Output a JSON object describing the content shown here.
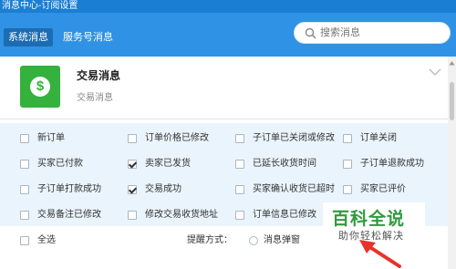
{
  "window": {
    "title": "消息中心-订阅设置"
  },
  "tabs": [
    {
      "label": "系统消息",
      "active": true
    },
    {
      "label": "服务号消息",
      "active": false
    }
  ],
  "search": {
    "placeholder": "搜索消息"
  },
  "card": {
    "title": "交易消息",
    "subtitle": "交易消息",
    "icon": "dollar-coin-icon"
  },
  "options": [
    {
      "label": "新订单",
      "checked": false
    },
    {
      "label": "订单价格已修改",
      "checked": false
    },
    {
      "label": "子订单已关闭或修改",
      "checked": false
    },
    {
      "label": "订单关闭",
      "checked": false
    },
    {
      "label": "买家已付款",
      "checked": false
    },
    {
      "label": "卖家已发货",
      "checked": true
    },
    {
      "label": "已延长收货时间",
      "checked": false
    },
    {
      "label": "子订单退款成功",
      "checked": false
    },
    {
      "label": "子订单打款成功",
      "checked": false
    },
    {
      "label": "交易成功",
      "checked": true
    },
    {
      "label": "买家确认收货已超时",
      "checked": false
    },
    {
      "label": "买家已评价",
      "checked": false
    },
    {
      "label": "交易备注已修改",
      "checked": false
    },
    {
      "label": "修改交易收货地址",
      "checked": false
    },
    {
      "label": "订单信息已修改",
      "checked": false
    }
  ],
  "footer": {
    "select_all": "全选",
    "reminder_label": "提醒方式：",
    "reminder_option": "消息弹窗"
  },
  "watermark": {
    "main": "百科全说",
    "sub": "助你轻松解决"
  },
  "colors": {
    "header": "#2f92e4",
    "active_tab": "#1c6cb4",
    "grid_bg": "#eaf4fc",
    "icon_green": "#35b13d",
    "arrow": "#e8332a"
  }
}
